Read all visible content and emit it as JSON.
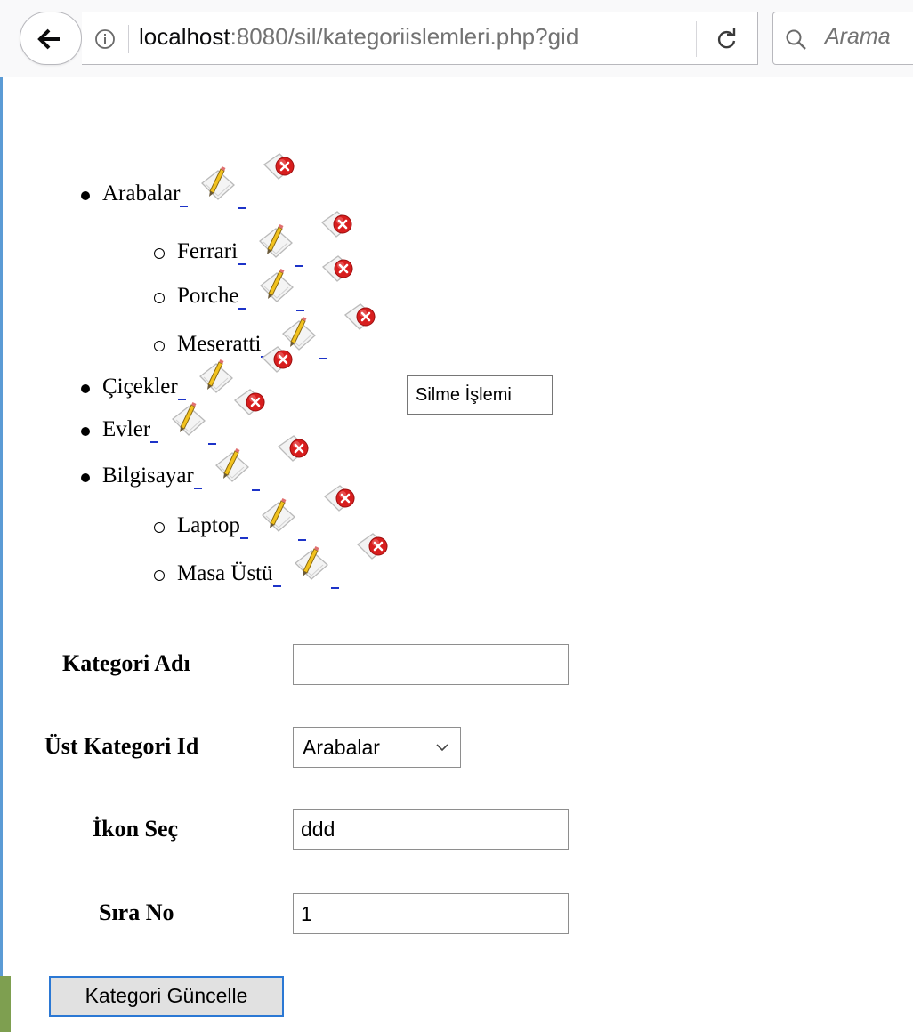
{
  "browser": {
    "url_host": "localhost",
    "url_rest": ":8080/sil/kategoriislemleri.php?gid",
    "search_placeholder": "Arama"
  },
  "categories": [
    {
      "name": "Arabalar",
      "level": 0
    },
    {
      "name": "Ferrari",
      "level": 1
    },
    {
      "name": "Porche",
      "level": 1
    },
    {
      "name": "Meseratti",
      "level": 1
    },
    {
      "name": "Çiçekler",
      "level": 0
    },
    {
      "name": "Evler",
      "level": 0
    },
    {
      "name": "Bilgisayar",
      "level": 0
    },
    {
      "name": "Laptop",
      "level": 1
    },
    {
      "name": "Masa Üstü",
      "level": 1
    }
  ],
  "tooltip": "Silme İşlemi",
  "form": {
    "name_label": "Kategori Adı",
    "name_value": "",
    "parent_label": "Üst Kategori Id",
    "parent_value": "Arabalar",
    "icon_label": "İkon Seç",
    "icon_value": "ddd",
    "order_label": "Sıra No",
    "order_value": "1",
    "submit_label": "Kategori Güncelle"
  }
}
